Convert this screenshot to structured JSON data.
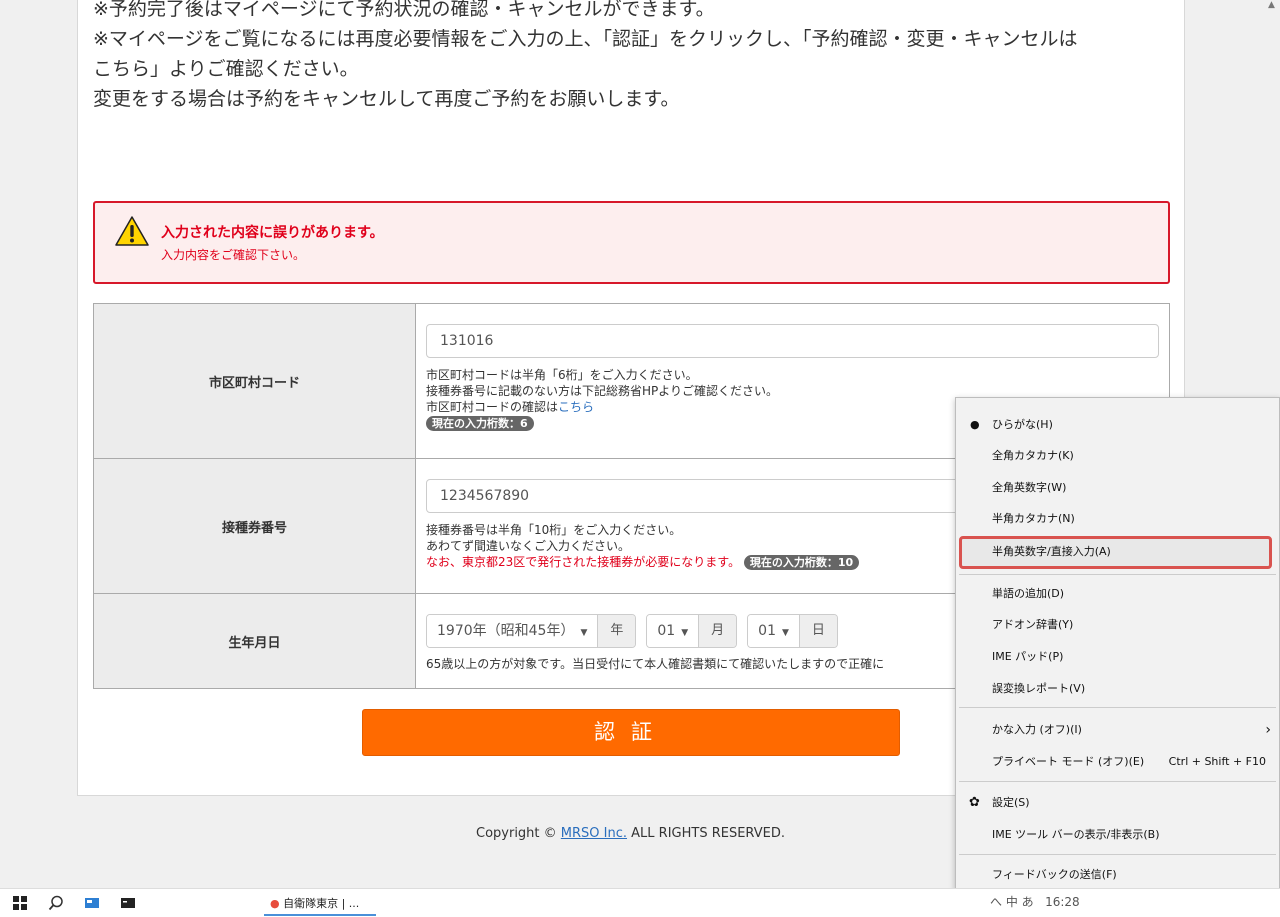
{
  "notes": [
    "※予約完了後はマイページにて予約状況の確認・キャンセルができます。",
    "※マイページをご覧になるには再度必要情報をご入力の上、「認証」をクリックし、「予約確認・変更・キャンセルは",
    "こちら」よりご確認ください。",
    "変更をする場合は予約をキャンセルして再度ご予約をお願いします。"
  ],
  "error": {
    "title": "入力された内容に誤りがあります。",
    "message": "入力内容をご確認下さい。",
    "icon": "warning-icon"
  },
  "form": {
    "municipality": {
      "label": "市区町村コード",
      "value": "131016",
      "help1": "市区町村コードは半角「6桁」をご入力ください。",
      "help2": "接種券番号に記載のない方は下記総務省HPよりご確認ください。",
      "help3_prefix": "市区町村コードの確認は",
      "help3_link": "こちら",
      "counter": "現在の入力桁数：6"
    },
    "voucher": {
      "label": "接種券番号",
      "value": "1234567890",
      "help1": "接種券番号は半角「10桁」をご入力ください。",
      "help2": "あわてず間違いなくご入力ください。",
      "help3": "なお、東京都23区で発行された接種券が必要になります。",
      "counter": "現在の入力桁数：10"
    },
    "birthdate": {
      "label": "生年月日",
      "year": "1970年（昭和45年）",
      "year_unit": "年",
      "month": "01",
      "month_unit": "月",
      "day": "01",
      "day_unit": "日",
      "help": "65歳以上の方が対象です。当日受付にて本人確認書類にて確認いたしますので正確に"
    }
  },
  "submit_label": "認証",
  "copyright": {
    "prefix": "Copyright © ",
    "link": "MRSO Inc.",
    "suffix": " ALL RIGHTS RESERVED."
  },
  "ime_menu": {
    "items": [
      {
        "label": "ひらがな(H)",
        "selected": true
      },
      {
        "label": "全角カタカナ(K)"
      },
      {
        "label": "全角英数字(W)"
      },
      {
        "label": "半角カタカナ(N)"
      },
      {
        "label": "半角英数字/直接入力(A)",
        "highlighted": true
      },
      {
        "label": "単語の追加(D)"
      },
      {
        "label": "アドオン辞書(Y)"
      },
      {
        "label": "IME パッド(P)"
      },
      {
        "label": "誤変換レポート(V)"
      },
      {
        "label": "かな入力 (オフ)(I)"
      },
      {
        "label": "プライベート モード (オフ)(E)",
        "shortcut": "Ctrl + Shift + F10"
      },
      {
        "label": "設定(S)"
      },
      {
        "label": "IME ツール バーの表示/非表示(B)"
      },
      {
        "label": "フィードバックの送信(F)"
      }
    ]
  },
  "taskbar": {
    "app_label": "自衛隊東京 | ...",
    "tray_text": "へ 中 あ",
    "time": "16:28"
  }
}
